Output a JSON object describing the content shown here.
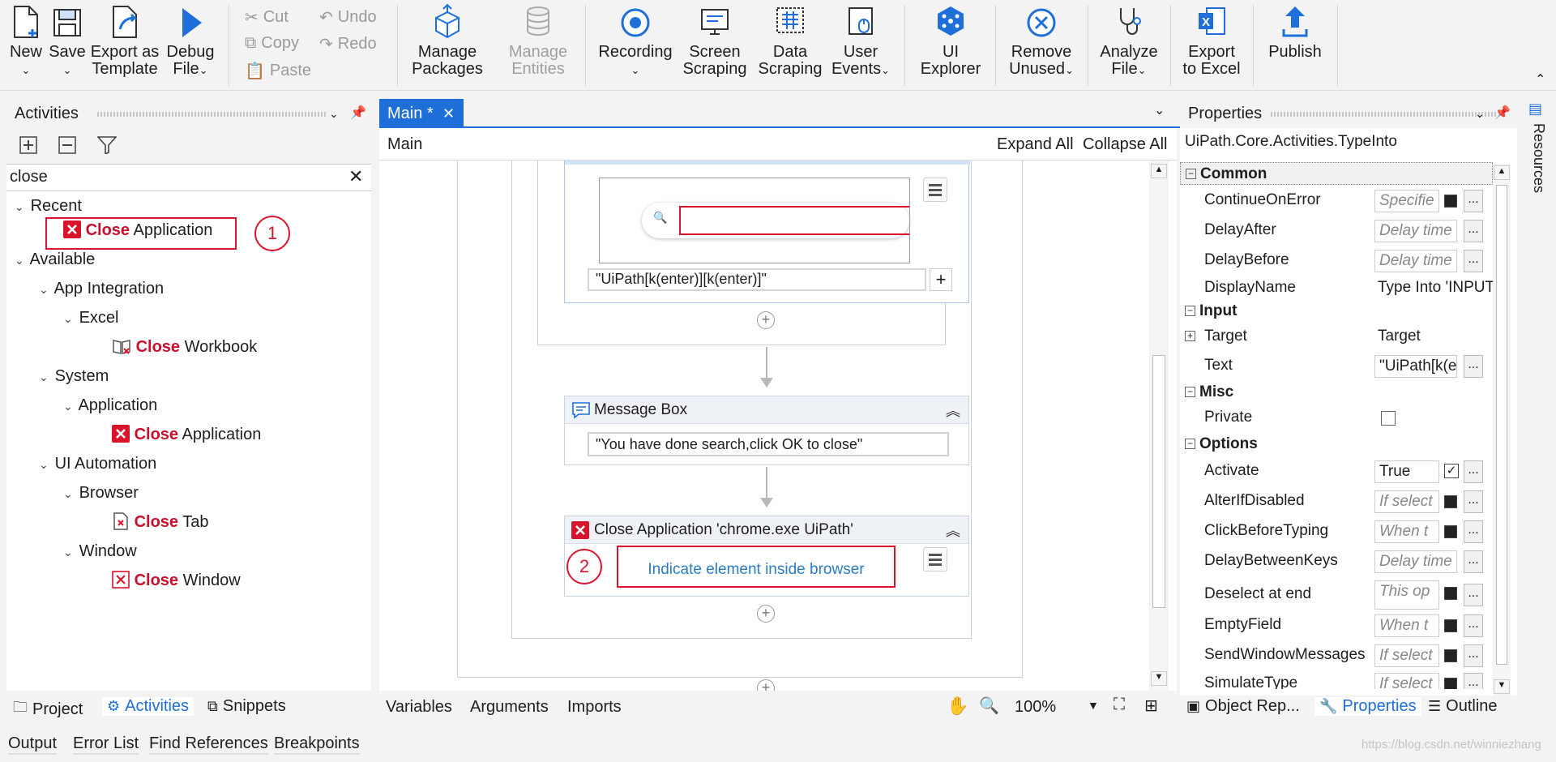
{
  "ribbon": {
    "new": "New",
    "save": "Save",
    "export_template_1": "Export as",
    "export_template_2": "Template",
    "debug_1": "Debug",
    "debug_2": "File",
    "cut": "Cut",
    "copy": "Copy",
    "paste": "Paste",
    "undo": "Undo",
    "redo": "Redo",
    "manage_packages_1": "Manage",
    "manage_packages_2": "Packages",
    "manage_entities_1": "Manage",
    "manage_entities_2": "Entities",
    "recording": "Recording",
    "screen_scraping_1": "Screen",
    "screen_scraping_2": "Scraping",
    "data_scraping_1": "Data",
    "data_scraping_2": "Scraping",
    "user_events_1": "User",
    "user_events_2": "Events",
    "ui_explorer_1": "UI",
    "ui_explorer_2": "Explorer",
    "remove_unused_1": "Remove",
    "remove_unused_2": "Unused",
    "analyze_file_1": "Analyze",
    "analyze_file_2": "File",
    "export_excel_1": "Export",
    "export_excel_2": "to Excel",
    "publish": "Publish"
  },
  "activities": {
    "title": "Activities",
    "search_value": "close",
    "recent": "Recent",
    "available": "Available",
    "app_integration": "App Integration",
    "excel": "Excel",
    "system": "System",
    "application": "Application",
    "ui_automation": "UI Automation",
    "browser": "Browser",
    "window": "Window",
    "kw": "Close",
    "recent_item": " Application",
    "workbook": " Workbook",
    "app_item": " Application",
    "tab": " Tab",
    "win_item": " Window",
    "marker1": "1",
    "bottom_tabs": [
      "Project",
      "Activities",
      "Snippets"
    ]
  },
  "designer": {
    "tab": "Main *",
    "breadcrumb": "Main",
    "expand_all": "Expand All",
    "collapse_all": "Collapse All",
    "typeinto_text": "\"UiPath[k(enter)][k(enter)]\"",
    "msgbox_title": "Message Box",
    "msgbox_text": "\"You have done search,click OK to close\"",
    "closeapp_title": "Close Application 'chrome.exe UiPath'",
    "indicate": "Indicate element inside browser",
    "marker2": "2",
    "bottom": {
      "variables": "Variables",
      "arguments": "Arguments",
      "imports": "Imports",
      "zoom": "100%"
    }
  },
  "properties": {
    "title": "Properties",
    "type": "UiPath.Core.Activities.TypeInto",
    "cat_common": "Common",
    "cat_input": "Input",
    "cat_misc": "Misc",
    "cat_options": "Options",
    "rows": {
      "continue": {
        "name": "ContinueOnError",
        "val": "Specifie"
      },
      "delayafter": {
        "name": "DelayAfter",
        "val": "Delay time"
      },
      "delaybefore": {
        "name": "DelayBefore",
        "val": "Delay time"
      },
      "displayname": {
        "name": "DisplayName",
        "val": "Type Into 'INPUT"
      },
      "target": {
        "name": "Target",
        "val": "Target"
      },
      "text": {
        "name": "Text",
        "val": "\"UiPath[k(e"
      },
      "private": {
        "name": "Private"
      },
      "activate": {
        "name": "Activate",
        "val": "True"
      },
      "alterifdisabled": {
        "name": "AlterIfDisabled",
        "val": "If select"
      },
      "clickbefore": {
        "name": "ClickBeforeTyping",
        "val": "When t"
      },
      "delaybetween": {
        "name": "DelayBetweenKeys",
        "val": "Delay time"
      },
      "deselect": {
        "name": "Deselect at end",
        "val": "This op"
      },
      "emptyfield": {
        "name": "EmptyField",
        "val": "When t"
      },
      "sendwindow": {
        "name": "SendWindowMessages",
        "val": "If select"
      },
      "simulatetype": {
        "name": "SimulateType",
        "val": "If select"
      }
    },
    "bottom_tabs": [
      "Object Rep...",
      "Properties",
      "Outline"
    ]
  },
  "side_resources": "Resources",
  "output_bar": [
    "Output",
    "Error List",
    "Find References",
    "Breakpoints"
  ],
  "watermark": "https://blog.csdn.net/winniezhang"
}
